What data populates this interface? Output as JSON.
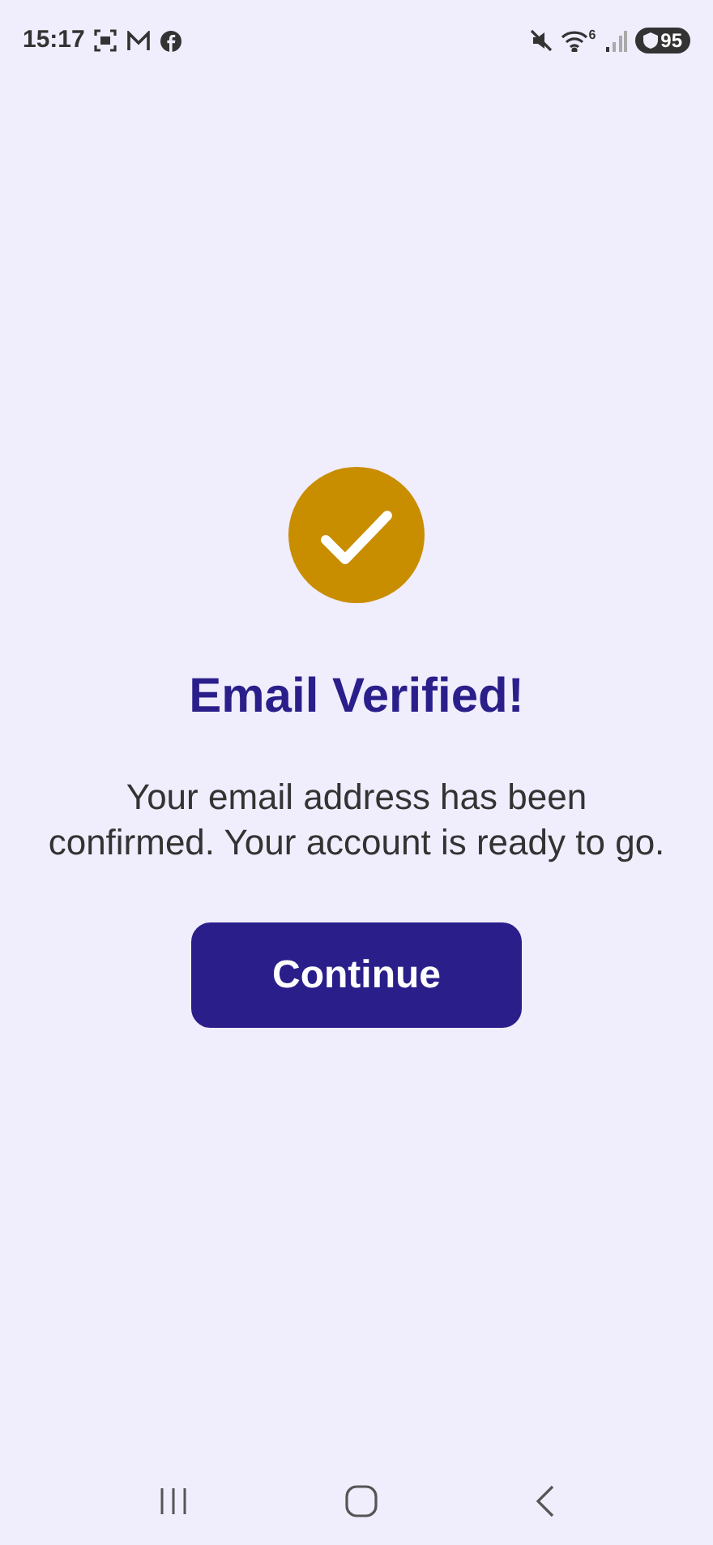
{
  "status_bar": {
    "time": "15:17",
    "wifi_tag": "6",
    "battery": "95"
  },
  "title": "Email Verified!",
  "message": "Your email address has been confirmed. Your account is ready to go.",
  "button": {
    "label": "Continue"
  }
}
